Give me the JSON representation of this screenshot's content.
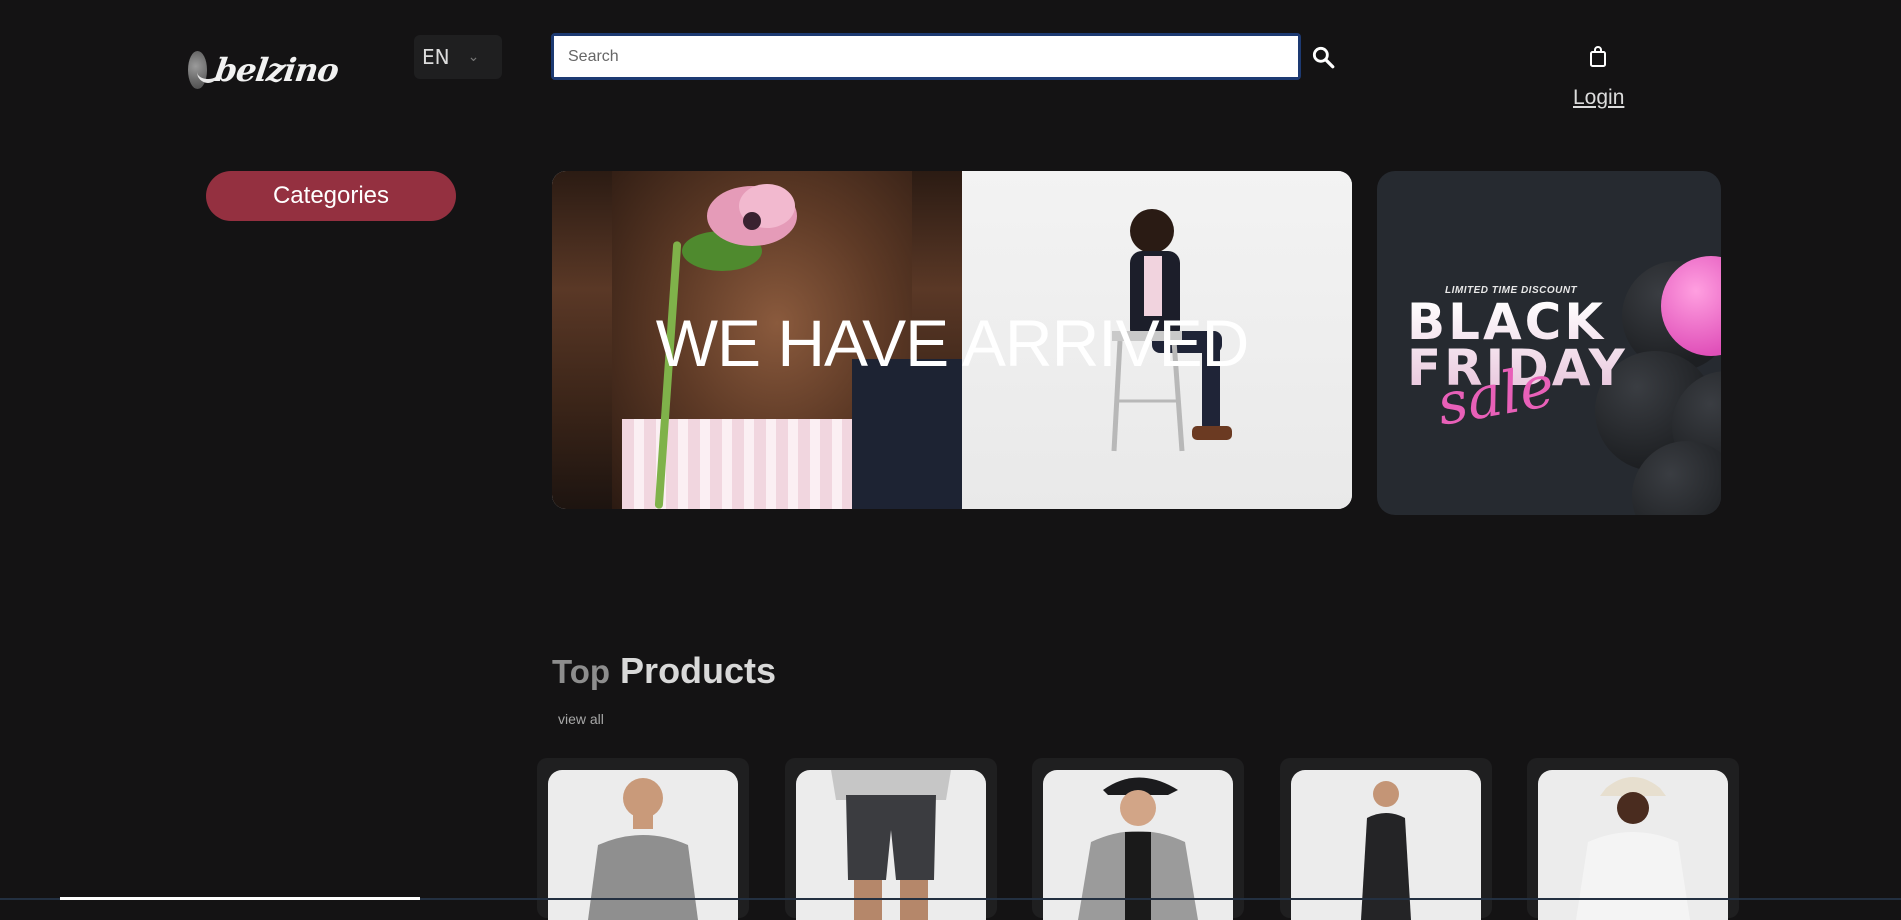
{
  "header": {
    "logo_text": "belzino",
    "language": "EN",
    "search_placeholder": "Search",
    "login_label": "Login"
  },
  "sidebar": {
    "categories_label": "Categories"
  },
  "hero": {
    "title": "WE HAVE ARRIVED"
  },
  "promo": {
    "limited": "LIMITED TIME DISCOUNT",
    "line1": "BLACK",
    "line2": "FRIDAY",
    "script": "sale"
  },
  "top_products": {
    "title_light": "Top",
    "title_bold": "Products",
    "view_all": "view all",
    "items": [
      {
        "name": "grey-tshirt"
      },
      {
        "name": "charcoal-shorts"
      },
      {
        "name": "grey-hoodie"
      },
      {
        "name": "black-sweatshirt"
      },
      {
        "name": "white-tshirt"
      }
    ]
  },
  "colors": {
    "background": "#141314",
    "accent": "#943040",
    "search_border": "#1d3a72"
  }
}
